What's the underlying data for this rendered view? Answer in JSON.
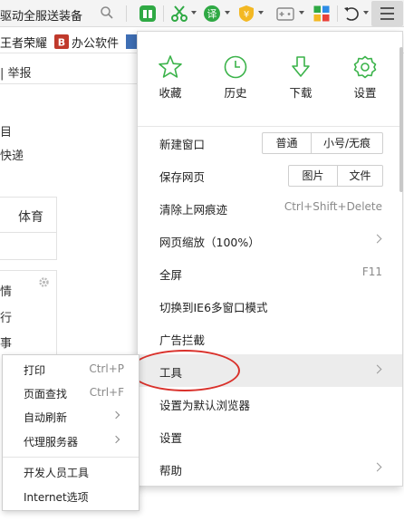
{
  "toolbar": {
    "search_text": "驱动全服送装备"
  },
  "bookmarks": {
    "items": [
      "王者荣耀",
      "办公软件"
    ]
  },
  "page": {
    "report_label": "| 举报",
    "left_texts": [
      "目",
      "快递"
    ],
    "tab_label": "体育",
    "list_texts": [
      "情",
      "行",
      "事"
    ]
  },
  "menu": {
    "quick_actions": [
      "收藏",
      "历史",
      "下载",
      "设置"
    ],
    "items": {
      "new_window": "新建窗口",
      "new_window_opts": [
        "普通",
        "小号/无痕"
      ],
      "save_page": "保存网页",
      "save_page_opts": [
        "图片",
        "文件"
      ],
      "clear_traces": "清除上网痕迹",
      "clear_traces_shortcut": "Ctrl+Shift+Delete",
      "zoom": "网页缩放（100%）",
      "fullscreen": "全屏",
      "fullscreen_shortcut": "F11",
      "ie6_mode": "切换到IE6多窗口模式",
      "ad_block": "广告拦截",
      "tools": "工具",
      "set_default": "设置为默认浏览器",
      "settings": "设置",
      "help": "帮助"
    }
  },
  "submenu": {
    "print": "打印",
    "print_shortcut": "Ctrl+P",
    "find": "页面查找",
    "find_shortcut": "Ctrl+F",
    "auto_refresh": "自动刷新",
    "proxy": "代理服务器",
    "dev_tools": "开发人员工具",
    "internet_options": "Internet选项"
  },
  "colors": {
    "accent_green": "#3bb34a",
    "highlight_red": "#d9312b",
    "icon_gray": "#7a7a7a"
  }
}
